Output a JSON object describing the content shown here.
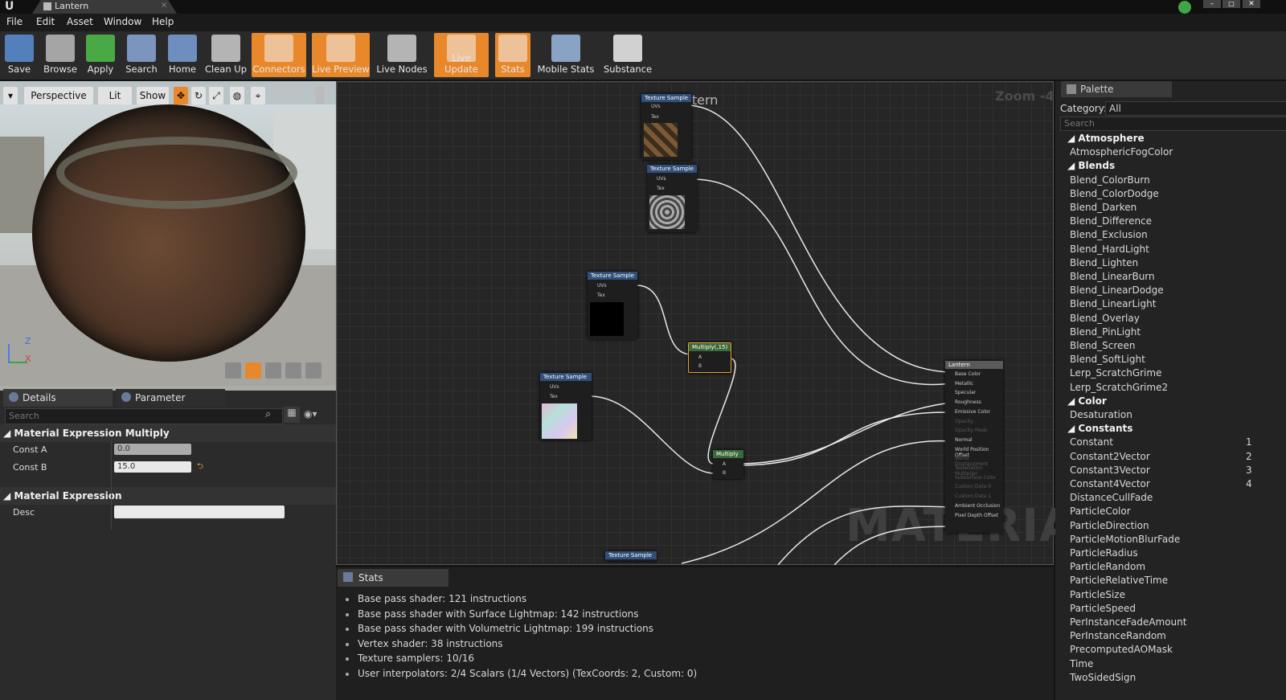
{
  "window": {
    "tab_title": "Lantern",
    "ue_logo": "U"
  },
  "menu": [
    "File",
    "Edit",
    "Asset",
    "Window",
    "Help"
  ],
  "toolbar": [
    {
      "label": "Save",
      "icon": "save-icon",
      "active": false
    },
    {
      "label": "Browse",
      "icon": "browse-icon",
      "active": false
    },
    {
      "label": "Apply",
      "icon": "apply-icon",
      "active": false
    },
    {
      "label": "Search",
      "icon": "search-icon",
      "active": false
    },
    {
      "label": "Home",
      "icon": "home-icon",
      "active": false
    },
    {
      "label": "Clean Up",
      "icon": "clean-up-icon",
      "active": false
    },
    {
      "label": "Connectors",
      "icon": "connectors-icon",
      "active": true
    },
    {
      "label": "Live Preview",
      "icon": "live-preview-icon",
      "active": true
    },
    {
      "label": "Live Nodes",
      "icon": "live-nodes-icon",
      "active": false
    },
    {
      "label": "Live Update",
      "icon": "live-update-icon",
      "active": true
    },
    {
      "label": "Stats",
      "icon": "stats-icon",
      "active": true
    },
    {
      "label": "Mobile Stats",
      "icon": "mobile-stats-icon",
      "active": false
    },
    {
      "label": "Substance",
      "icon": "substance-icon",
      "active": false
    }
  ],
  "viewport": {
    "perspective": "Perspective",
    "lit": "Lit",
    "show": "Show",
    "axis_z": "Z",
    "axis_x": "X"
  },
  "details": {
    "tab1": "Details",
    "tab2": "Parameter Default:",
    "search_placeholder": "Search",
    "section1": "Material Expression Multiply",
    "const_a_label": "Const A",
    "const_a_value": "0.0",
    "const_b_label": "Const B",
    "const_b_value": "15.0",
    "section2": "Material Expression",
    "desc_label": "Desc",
    "desc_value": ""
  },
  "graph": {
    "title": "Lantern",
    "zoom": "Zoom -4",
    "watermark": "MATERIAL",
    "node_texture": "Texture Sample",
    "pin_uvs": "UVs",
    "pin_tex": "Tex",
    "node_multiply15": "Multiply(,15)",
    "node_multiply": "Multiply",
    "pin_a": "A",
    "pin_b": "B",
    "result_node": "Lantern",
    "result_pins": [
      "Base Color",
      "Metallic",
      "Specular",
      "Roughness",
      "Emissive Color",
      "Opacity",
      "Opacity Mask",
      "Normal",
      "World Position Offset",
      "World Displacement",
      "Tessellation Multiplier",
      "Subsurface Color",
      "Custom Data 0",
      "Custom Data 1",
      "Ambient Occlusion",
      "Pixel Depth Offset"
    ]
  },
  "stats": {
    "tab": "Stats",
    "lines": [
      "Base pass shader: 121 instructions",
      "Base pass shader with Surface Lightmap: 142 instructions",
      "Base pass shader with Volumetric Lightmap: 199 instructions",
      "Vertex shader: 38 instructions",
      "Texture samplers: 10/16",
      "User interpolators: 2/4 Scalars (1/4 Vectors) (TexCoords: 2, Custom: 0)"
    ]
  },
  "palette": {
    "tab": "Palette",
    "category_label": "Category:",
    "category_value": "All",
    "search_placeholder": "Search",
    "groups": [
      {
        "name": "Atmosphere",
        "items": [
          {
            "label": "AtmosphericFogColor",
            "num": ""
          }
        ]
      },
      {
        "name": "Blends",
        "items": [
          {
            "label": "Blend_ColorBurn",
            "num": ""
          },
          {
            "label": "Blend_ColorDodge",
            "num": ""
          },
          {
            "label": "Blend_Darken",
            "num": ""
          },
          {
            "label": "Blend_Difference",
            "num": ""
          },
          {
            "label": "Blend_Exclusion",
            "num": ""
          },
          {
            "label": "Blend_HardLight",
            "num": ""
          },
          {
            "label": "Blend_Lighten",
            "num": ""
          },
          {
            "label": "Blend_LinearBurn",
            "num": ""
          },
          {
            "label": "Blend_LinearDodge",
            "num": ""
          },
          {
            "label": "Blend_LinearLight",
            "num": ""
          },
          {
            "label": "Blend_Overlay",
            "num": ""
          },
          {
            "label": "Blend_PinLight",
            "num": ""
          },
          {
            "label": "Blend_Screen",
            "num": ""
          },
          {
            "label": "Blend_SoftLight",
            "num": ""
          },
          {
            "label": "Lerp_ScratchGrime",
            "num": ""
          },
          {
            "label": "Lerp_ScratchGrime2",
            "num": ""
          }
        ]
      },
      {
        "name": "Color",
        "items": [
          {
            "label": "Desaturation",
            "num": ""
          }
        ]
      },
      {
        "name": "Constants",
        "items": [
          {
            "label": "Constant",
            "num": "1"
          },
          {
            "label": "Constant2Vector",
            "num": "2"
          },
          {
            "label": "Constant3Vector",
            "num": "3"
          },
          {
            "label": "Constant4Vector",
            "num": "4"
          },
          {
            "label": "DistanceCullFade",
            "num": ""
          },
          {
            "label": "ParticleColor",
            "num": ""
          },
          {
            "label": "ParticleDirection",
            "num": ""
          },
          {
            "label": "ParticleMotionBlurFade",
            "num": ""
          },
          {
            "label": "ParticleRadius",
            "num": ""
          },
          {
            "label": "ParticleRandom",
            "num": ""
          },
          {
            "label": "ParticleRelativeTime",
            "num": ""
          },
          {
            "label": "ParticleSize",
            "num": ""
          },
          {
            "label": "ParticleSpeed",
            "num": ""
          },
          {
            "label": "PerInstanceFadeAmount",
            "num": ""
          },
          {
            "label": "PerInstanceRandom",
            "num": ""
          },
          {
            "label": "PrecomputedAOMask",
            "num": ""
          },
          {
            "label": "Time",
            "num": ""
          },
          {
            "label": "TwoSidedSign",
            "num": ""
          }
        ]
      }
    ]
  }
}
